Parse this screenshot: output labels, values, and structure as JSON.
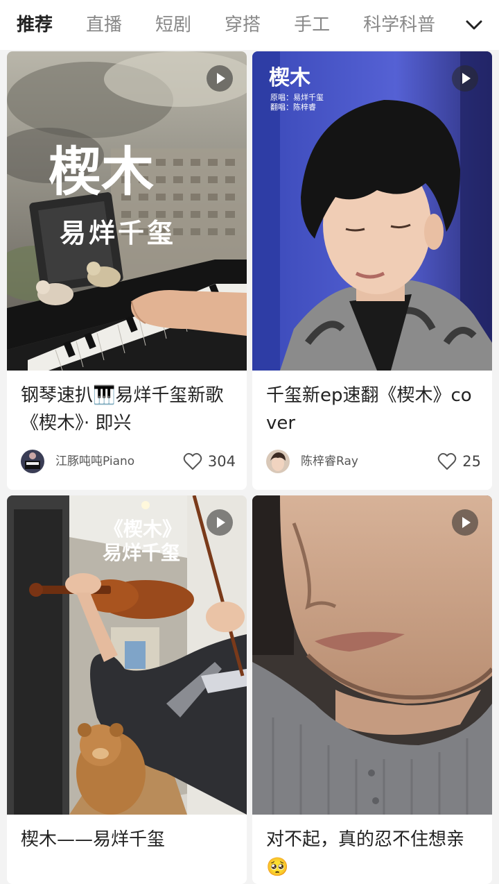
{
  "categories": {
    "tabs": [
      "推荐",
      "直播",
      "短剧",
      "穿搭",
      "手工",
      "科学科普"
    ],
    "active_index": 0
  },
  "colors": {
    "background": "#f3f3f3",
    "card": "#ffffff",
    "active_tab": "#222222",
    "inactive_tab": "#888888"
  },
  "feed": [
    {
      "title": "钢琴速扒🎹易烊千玺新歌《楔木》· 即兴",
      "author": "江豚吨吨Piano",
      "likes": "304",
      "cover": {
        "big_text": "楔木",
        "sub_text": "易烊千玺"
      }
    },
    {
      "title": "千玺新ep速翻《楔木》cover",
      "author": "陈梓睿Ray",
      "likes": "25",
      "cover": {
        "big_text": "楔木",
        "line1": "原唱：易烊千玺",
        "line2": "翻唱：陈梓睿"
      }
    },
    {
      "title": "楔木——易烊千玺",
      "cover": {
        "line1": "《楔木》",
        "line2": "易烊千玺"
      }
    },
    {
      "title": "对不起，真的忍不住想亲🥺"
    }
  ],
  "icons": {
    "expand": "chevron-down-icon",
    "play": "play-icon",
    "like": "heart-outline-icon"
  }
}
